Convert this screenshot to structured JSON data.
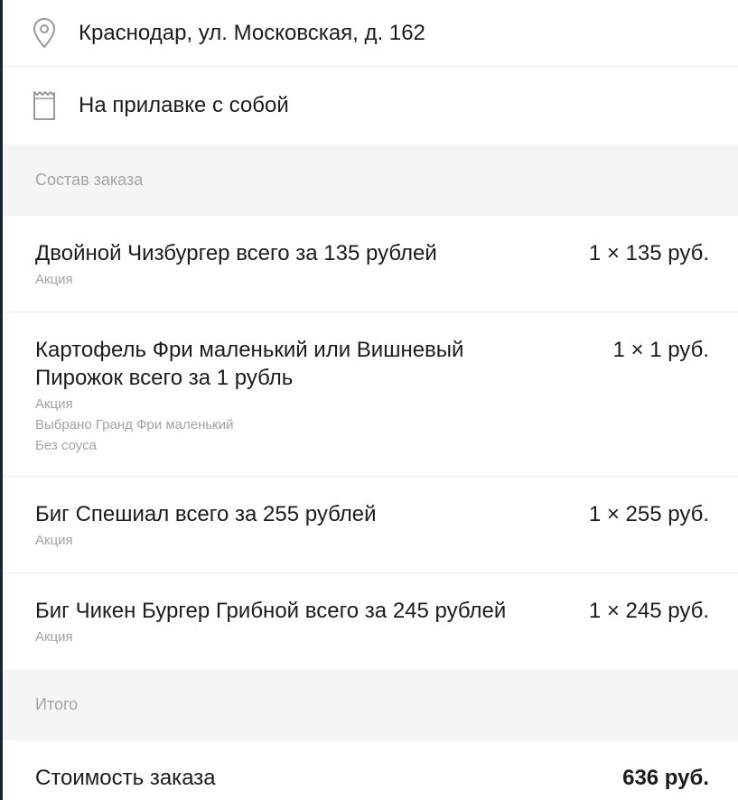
{
  "location": {
    "address": "Краснодар, ул. Московская, д. 162",
    "address_icon": "map-pin-icon",
    "pickup_method": "На прилавке с собой",
    "pickup_icon": "receipt-icon"
  },
  "order": {
    "section_title": "Состав заказа",
    "items": [
      {
        "name": "Двойной Чизбургер всего за 135 рублей",
        "details": [
          "Акция"
        ],
        "quantity_price": "1 × 135 руб."
      },
      {
        "name": "Картофель Фри маленький или Вишневый Пирожок всего за 1 рубль",
        "details": [
          "Акция",
          "Выбрано Гранд Фри маленький",
          "Без соуса"
        ],
        "quantity_price": "1 × 1 руб."
      },
      {
        "name": "Биг Спешиал всего за 255 рублей",
        "details": [
          "Акция"
        ],
        "quantity_price": "1 × 255 руб."
      },
      {
        "name": "Биг Чикен Бургер Грибной всего за 245 рублей",
        "details": [
          "Акция"
        ],
        "quantity_price": "1 × 245 руб."
      }
    ]
  },
  "total": {
    "section_title": "Итого",
    "label": "Стоимость заказа",
    "value": "636 руб."
  },
  "colors": {
    "text_primary": "#1c1c1c",
    "text_secondary": "#a3a3a3",
    "section_background": "#f5f5f5",
    "divider": "#ececec"
  }
}
